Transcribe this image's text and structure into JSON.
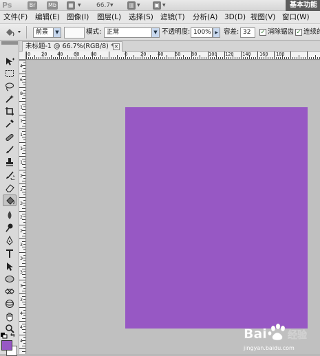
{
  "app": {
    "logo": "Ps",
    "bridge_label": "Br",
    "minibridge_label": "Mb",
    "zoom_readout": "66.7",
    "workspace_label": "基本功能"
  },
  "menu": {
    "items": [
      "文件(F)",
      "编辑(E)",
      "图像(I)",
      "图层(L)",
      "选择(S)",
      "滤镜(T)",
      "分析(A)",
      "3D(D)",
      "视图(V)",
      "窗口(W)"
    ]
  },
  "options": {
    "fill_source": "前景",
    "mode_label": "模式:",
    "mode_value": "正常",
    "opacity_label": "不透明度:",
    "opacity_value": "100%",
    "tolerance_label": "容差:",
    "tolerance_value": "32",
    "antialias_label": "消除锯齿",
    "antialias_checked": true,
    "contiguous_label": "连续的",
    "contiguous_checked": true
  },
  "document": {
    "tab_title": "未标题-1 @ 66.7%(RGB/8) *",
    "fill_color": "#9758c4"
  },
  "ruler": {
    "h_labels": [
      "0",
      "20",
      "40",
      "60",
      "80",
      "0",
      "20",
      "40",
      "60",
      "80",
      "100",
      "120",
      "140",
      "160",
      "180"
    ],
    "v_labels": [
      "4",
      "6",
      "8",
      "1",
      "1",
      "1",
      "1",
      "1",
      "2",
      "2",
      "2",
      "2",
      "2",
      "3",
      "3",
      "3",
      "3",
      "3",
      "4",
      "4",
      "4"
    ]
  },
  "tools": [
    {
      "name": "move-tool",
      "icon": "move-icon"
    },
    {
      "name": "marquee-tool",
      "icon": "marquee-icon"
    },
    {
      "name": "lasso-tool",
      "icon": "lasso-icon"
    },
    {
      "name": "quick-select-tool",
      "icon": "magic-wand-icon"
    },
    {
      "name": "crop-tool",
      "icon": "crop-icon"
    },
    {
      "name": "eyedropper-tool",
      "icon": "eyedropper-icon"
    },
    {
      "name": "healing-brush-tool",
      "icon": "bandage-icon"
    },
    {
      "name": "brush-tool",
      "icon": "brush-icon"
    },
    {
      "name": "clone-stamp-tool",
      "icon": "stamp-icon"
    },
    {
      "name": "history-brush-tool",
      "icon": "history-brush-icon"
    },
    {
      "name": "eraser-tool",
      "icon": "eraser-icon"
    },
    {
      "name": "paint-bucket-tool",
      "icon": "paint-bucket-icon",
      "active": true
    },
    {
      "name": "blur-tool",
      "icon": "blur-icon"
    },
    {
      "name": "dodge-tool",
      "icon": "dodge-icon"
    },
    {
      "name": "pen-tool",
      "icon": "pen-icon"
    },
    {
      "name": "type-tool",
      "icon": "type-icon"
    },
    {
      "name": "path-select-tool",
      "icon": "path-select-icon"
    },
    {
      "name": "shape-tool",
      "icon": "ellipse-icon"
    },
    {
      "name": "3d-rotate-tool",
      "icon": "3d-rotate-icon"
    },
    {
      "name": "3d-orbit-tool",
      "icon": "3d-orbit-icon"
    },
    {
      "name": "hand-tool",
      "icon": "hand-icon"
    },
    {
      "name": "zoom-tool",
      "icon": "zoom-icon"
    }
  ],
  "colors": {
    "foreground": "#9758c4",
    "background": "#ffffff",
    "canvas_bg": "#c0c0c0"
  },
  "watermark": {
    "brand": "Bai",
    "brand2": "经验",
    "url": "jingyan.baidu.com"
  }
}
